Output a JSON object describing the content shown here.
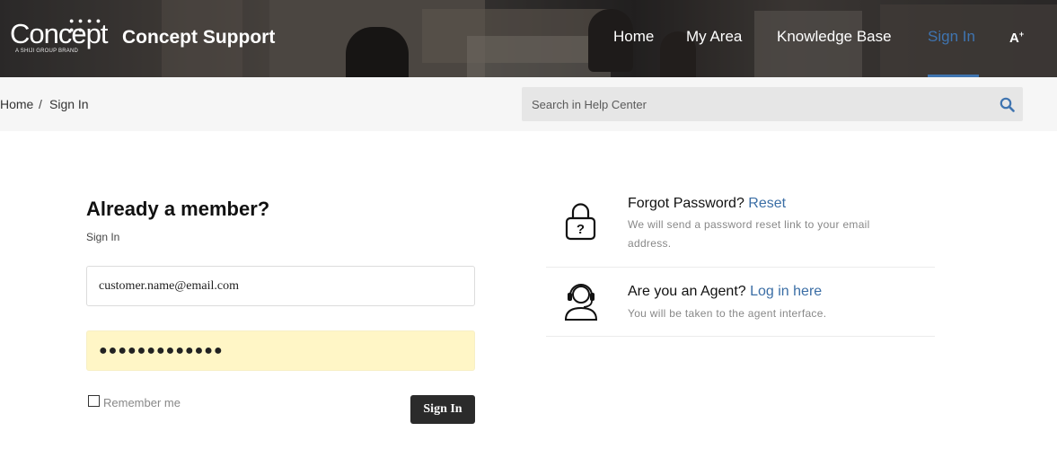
{
  "header": {
    "logo_word": "Concept",
    "logo_tagline": "A SHIJI GROUP BRAND",
    "site_title": "Concept Support",
    "nav": [
      {
        "label": "Home"
      },
      {
        "label": "My Area"
      },
      {
        "label": "Knowledge Base"
      },
      {
        "label": "Sign In",
        "active": true
      }
    ],
    "a11y_label": "A"
  },
  "breadcrumb": {
    "items": [
      "Home",
      "Sign In"
    ],
    "separator": "/"
  },
  "search": {
    "placeholder": "Search in Help Center"
  },
  "login": {
    "heading": "Already a member?",
    "subheading": "Sign In",
    "email_value": "customer.name@email.com",
    "password_value": "●●●●●●●●●●●●●",
    "remember_label": "Remember me",
    "remember_checked": false,
    "submit_label": "Sign In"
  },
  "forgot": {
    "title": "Forgot Password?",
    "link": "Reset",
    "description": "We will send a password reset link to your email address.",
    "icon": "lock-icon"
  },
  "agent": {
    "title": "Are you an Agent?",
    "link": "Log in here",
    "description": "You will be taken to the agent interface.",
    "icon": "headset-agent-icon"
  },
  "colors": {
    "accent": "#3f74b0",
    "link": "#3b6ea5",
    "button": "#2b2b2b",
    "autofill": "#fff6c6"
  }
}
